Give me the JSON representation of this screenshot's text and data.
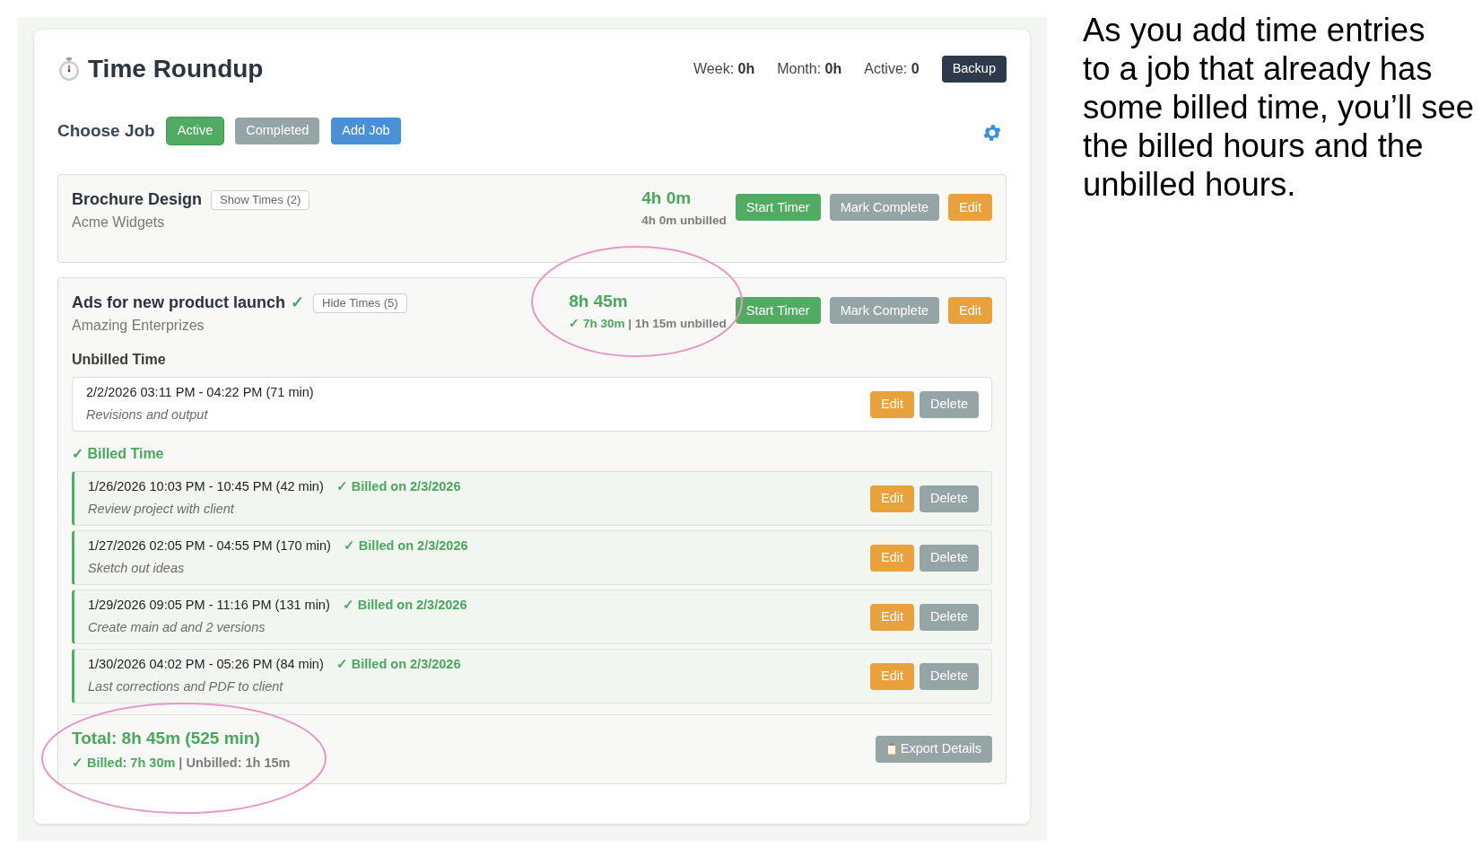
{
  "header": {
    "title": "Time Roundup",
    "stats": [
      {
        "label": "Week:",
        "value": "0h"
      },
      {
        "label": "Month:",
        "value": "0h"
      },
      {
        "label": "Active:",
        "value": "0"
      }
    ],
    "backup_button": "Backup"
  },
  "filter": {
    "label": "Choose Job",
    "buttons": [
      {
        "label": "Active",
        "kind": "filter",
        "selected": true
      },
      {
        "label": "Completed",
        "kind": "filter",
        "selected": false
      },
      {
        "label": "Add Job",
        "kind": "add"
      }
    ]
  },
  "jobs": [
    {
      "name": "Brochure Design",
      "client": "Acme Widgets",
      "toggle_label": "Show Times (2)",
      "expanded": false,
      "total": "4h 0m",
      "unbilled_summary": "4h 0m unbilled",
      "actions": [
        "Start Timer",
        "Mark Complete",
        "Edit"
      ]
    },
    {
      "name": "Ads for new product launch",
      "status_mark": "✓",
      "client": "Amazing Enterprizes",
      "toggle_label": "Hide Times (5)",
      "expanded": true,
      "total": "8h 45m",
      "billed_summary": "✓ 7h 30m",
      "unbilled_summary": " | 1h 15m unbilled",
      "actions": [
        "Start Timer",
        "Mark Complete",
        "Edit"
      ],
      "unbilled_heading": "Unbilled Time",
      "unbilled_entries": [
        {
          "time": "2/2/2026 03:11 PM - 04:22 PM (71 min)",
          "note": "Revisions and output",
          "buttons": [
            "Edit",
            "Delete"
          ]
        }
      ],
      "billed_heading": "✓ Billed Time",
      "billed_entries": [
        {
          "time": "1/26/2026 10:03 PM - 10:45 PM (42 min)",
          "billed_on": "✓ Billed on 2/3/2026",
          "note": "Review project with client",
          "buttons": [
            "Edit",
            "Delete"
          ]
        },
        {
          "time": "1/27/2026 02:05 PM - 04:55 PM (170 min)",
          "billed_on": "✓ Billed on 2/3/2026",
          "note": "Sketch out ideas",
          "buttons": [
            "Edit",
            "Delete"
          ]
        },
        {
          "time": "1/29/2026 09:05 PM - 11:16 PM (131 min)",
          "billed_on": "✓ Billed on 2/3/2026",
          "note": "Create main ad and 2 versions",
          "buttons": [
            "Edit",
            "Delete"
          ]
        },
        {
          "time": "1/30/2026 04:02 PM - 05:26 PM (84 min)",
          "billed_on": "✓ Billed on 2/3/2026",
          "note": "Last corrections and PDF to client",
          "buttons": [
            "Edit",
            "Delete"
          ]
        }
      ],
      "footer": {
        "total": "Total: 8h 45m (525 min)",
        "billed": "✓ Billed: 7h 30m",
        "unbilled": " | Unbilled: 1h 15m",
        "export_button": "Export Details"
      }
    }
  ],
  "caption_lines": [
    "As you add time entries",
    "to a job that already has",
    "some billed time, you’ll see",
    "the billed hours and the",
    "unbilled hours."
  ]
}
